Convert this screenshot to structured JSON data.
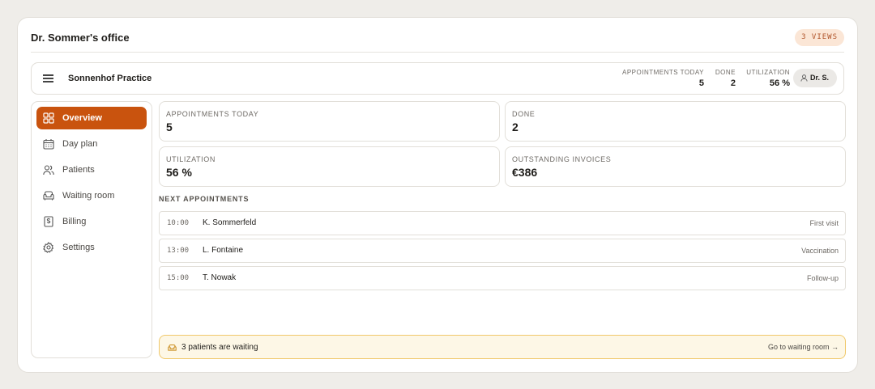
{
  "header": {
    "title": "Dr. Sommer's office",
    "views_badge": "3 VIEWS"
  },
  "topbar": {
    "practice_name": "Sonnenhof Practice",
    "stats": [
      {
        "label": "APPOINTMENTS TODAY",
        "value": "5"
      },
      {
        "label": "DONE",
        "value": "2"
      },
      {
        "label": "UTILIZATION",
        "value": "56 %"
      }
    ],
    "user": "Dr. S."
  },
  "sidebar": {
    "items": [
      {
        "label": "Overview",
        "icon": "grid-icon",
        "active": true
      },
      {
        "label": "Day plan",
        "icon": "calendar-icon"
      },
      {
        "label": "Patients",
        "icon": "users-icon"
      },
      {
        "label": "Waiting room",
        "icon": "sofa-icon"
      },
      {
        "label": "Billing",
        "icon": "invoice-icon"
      },
      {
        "label": "Settings",
        "icon": "gear-icon"
      }
    ]
  },
  "kpis": [
    {
      "label": "APPOINTMENTS TODAY",
      "value": "5"
    },
    {
      "label": "DONE",
      "value": "2"
    },
    {
      "label": "UTILIZATION",
      "value": "56 %"
    },
    {
      "label": "OUTSTANDING INVOICES",
      "value": "€386"
    }
  ],
  "appointments": {
    "title": "NEXT APPOINTMENTS",
    "rows": [
      {
        "time": "10:00",
        "name": "K. Sommerfeld",
        "type": "First visit"
      },
      {
        "time": "13:00",
        "name": "L. Fontaine",
        "type": "Vaccination"
      },
      {
        "time": "15:00",
        "name": "T. Nowak",
        "type": "Follow-up"
      }
    ]
  },
  "waiting": {
    "message": "3 patients are waiting",
    "link": "Go to waiting room →"
  },
  "colors": {
    "accent": "#c9530e",
    "badge_bg": "#fbe6d6",
    "waiting_bg": "#fdf7e6",
    "waiting_border": "#f0c86a"
  }
}
